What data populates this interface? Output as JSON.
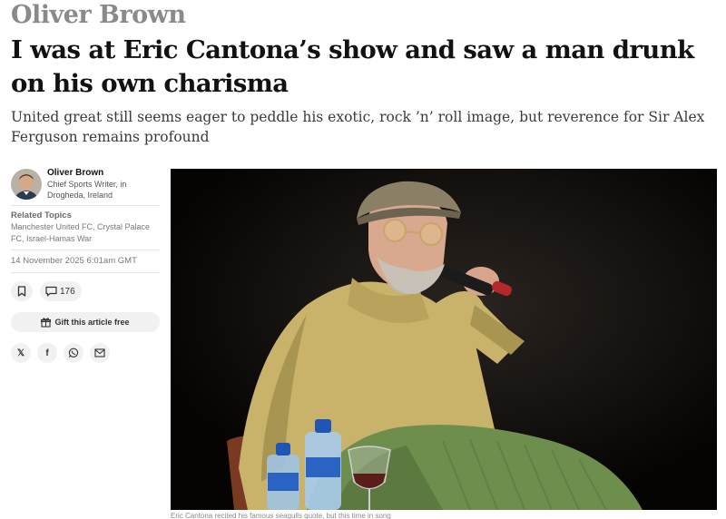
{
  "article": {
    "kicker": "Oliver Brown",
    "headline": "I was at Eric Cantona’s show and saw a man drunk on his own charisma",
    "standfirst": "United great still seems eager to peddle his exotic, rock ’n’ roll image, but reverence for Sir Alex Ferguson remains profound",
    "caption": "Eric Cantona recited his famous seagulls quote, but this time in song"
  },
  "byline": {
    "name": "Oliver Brown",
    "role": "Chief Sports Writer, in Drogheda, Ireland",
    "avatar_icon": "author-portrait"
  },
  "topics": {
    "label": "Related Topics",
    "text": "Manchester United FC, Crystal Palace FC, Israel-Hamas War"
  },
  "published": "14 November 2025 6:01am GMT",
  "actions": {
    "bookmark_icon": "bookmark-icon",
    "comment_icon": "comment-icon",
    "comment_count": "176",
    "gift_label": "Gift this article free",
    "gift_icon": "gift-icon"
  },
  "share": {
    "x_label": "𝕏",
    "facebook_label": "f",
    "icons": [
      "x-icon",
      "facebook-icon",
      "whatsapp-icon",
      "email-icon"
    ]
  },
  "colors": {
    "headline": "#121212",
    "kicker": "#8a8a8a",
    "pill_bg": "#f1f1f1",
    "photo_bg": "#050403"
  }
}
